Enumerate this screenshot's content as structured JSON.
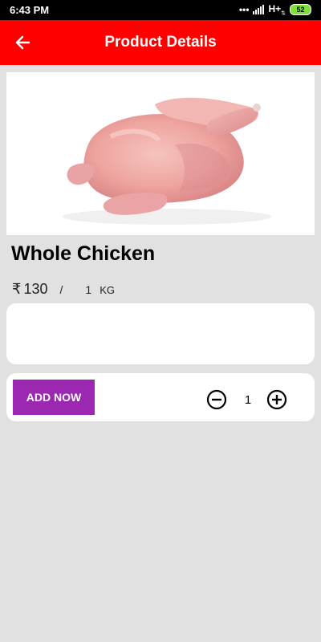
{
  "status_bar": {
    "time": "6:43 PM",
    "network": "H+",
    "battery": "52"
  },
  "app_bar": {
    "title": "Product Details",
    "back_icon": "arrow-left-icon"
  },
  "product": {
    "name": "Whole Chicken",
    "image": "whole-chicken-photo",
    "currency_symbol": "₹",
    "price": "130",
    "separator": "/",
    "quantity_unit": "1",
    "unit": "KG"
  },
  "actions": {
    "add_label": "ADD NOW",
    "quantity": "1",
    "minus_icon": "minus-circle-icon",
    "plus_icon": "plus-circle-icon"
  },
  "colors": {
    "app_bar": "#ff0000",
    "add_button": "#9c27b0",
    "background": "#e1e1e1",
    "battery": "#7ee03b"
  }
}
